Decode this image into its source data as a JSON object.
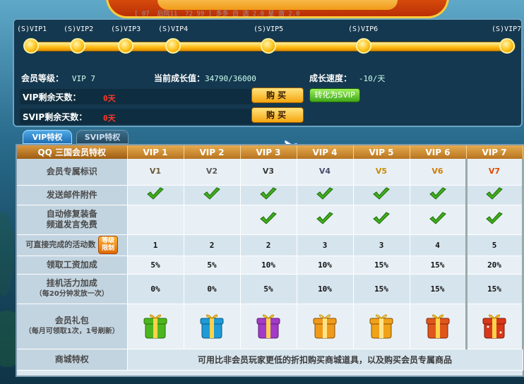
{
  "banner": {
    "sub_text": "[_07_ 后院11_ 72_99 ] 多多_自_选_2.0_星_谐_2.0"
  },
  "progress": {
    "levels": [
      "(S)VIP1",
      "(S)VIP2",
      "(S)VIP3",
      "(S)VIP4",
      "(S)VIP5",
      "(S)VIP6",
      "(S)VIP7"
    ]
  },
  "info": {
    "member_level_label": "会员等级：",
    "member_level_value": "VIP 7",
    "growth_label": "当前成长值：",
    "growth_value": "34790/36000",
    "speed_label": "成长速度：",
    "speed_value": "-10/天",
    "vip_days_label": "VIP剩余天数：",
    "vip_days_value": "0天",
    "svip_days_label": "SVIP剩余天数：",
    "svip_days_value": "0天",
    "buy_label": "购买",
    "convert_label": "转化为SVIP"
  },
  "tabs": [
    {
      "label": "VIP特权",
      "active": true
    },
    {
      "label": "SVIP特权",
      "active": false
    }
  ],
  "table": {
    "corner_header": "QQ 三国会员特权",
    "columns": [
      "VIP 1",
      "VIP 2",
      "VIP 3",
      "VIP 4",
      "VIP 5",
      "VIP 6",
      "VIP 7"
    ],
    "rows": {
      "badge": {
        "label": "会员专属标识",
        "values": [
          "V1",
          "V2",
          "V3",
          "V4",
          "V5",
          "V6",
          "V7"
        ]
      },
      "mail": {
        "label": "发送邮件附件"
      },
      "repair": {
        "label_1": "自动修复装备",
        "label_2": "频道发言免费"
      },
      "activity": {
        "label": "可直接完成的活动数",
        "tag": "等级限制",
        "values": [
          "1",
          "2",
          "2",
          "3",
          "3",
          "4",
          "5"
        ]
      },
      "salary": {
        "label": "领取工资加成",
        "values": [
          "5%",
          "5%",
          "10%",
          "10%",
          "15%",
          "15%",
          "20%"
        ]
      },
      "idle": {
        "label": "挂机活力加成",
        "sub": "（每20分钟发放一次）",
        "values": [
          "0%",
          "0%",
          "5%",
          "10%",
          "15%",
          "15%",
          "15%"
        ]
      },
      "gift": {
        "label": "会员礼包",
        "sub": "（每月可领取1次，1号刷新）"
      },
      "mall": {
        "label": "商城特权",
        "text": "可用比非会员玩家更低的折扣购买商城道具，以及购买会员专属商品"
      }
    }
  },
  "colors": {
    "gift": [
      "#4db61e",
      "#1e9ad6",
      "#a23bc7",
      "#f09a1a",
      "#f0a21a",
      "#e0561a",
      "#d8381a"
    ]
  }
}
